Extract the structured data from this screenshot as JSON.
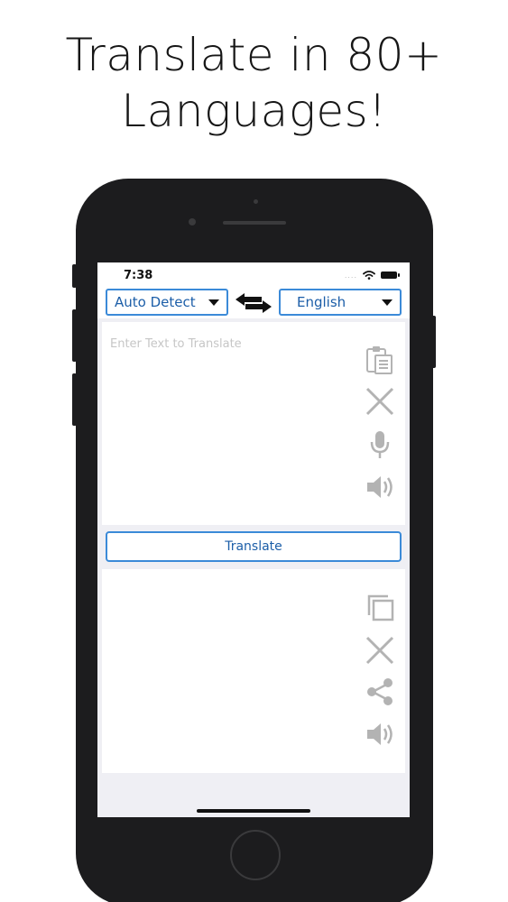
{
  "promo": {
    "headline_line1": "Translate in 80+",
    "headline_line2": "Languages!"
  },
  "status_bar": {
    "time": "7:38",
    "signal": "....",
    "icons": [
      "wifi-icon",
      "battery-icon"
    ]
  },
  "language_bar": {
    "source_language": "Auto Detect",
    "target_language": "English",
    "swap_icon": "swap-arrows-icon"
  },
  "input_panel": {
    "placeholder": "Enter Text to Translate",
    "icons": [
      "clipboard-icon",
      "clear-icon",
      "microphone-icon",
      "speaker-icon"
    ]
  },
  "translate_button": {
    "label": "Translate"
  },
  "output_panel": {
    "text": "",
    "icons": [
      "copy-icon",
      "clear-icon",
      "share-icon",
      "speaker-icon"
    ]
  },
  "colors": {
    "accent": "#3b8ad8",
    "accent_text": "#1c5ea8",
    "icon_gray": "#b3b3b3",
    "phone_frame": "#1c1c1e",
    "screen_bg": "#efeff4"
  }
}
